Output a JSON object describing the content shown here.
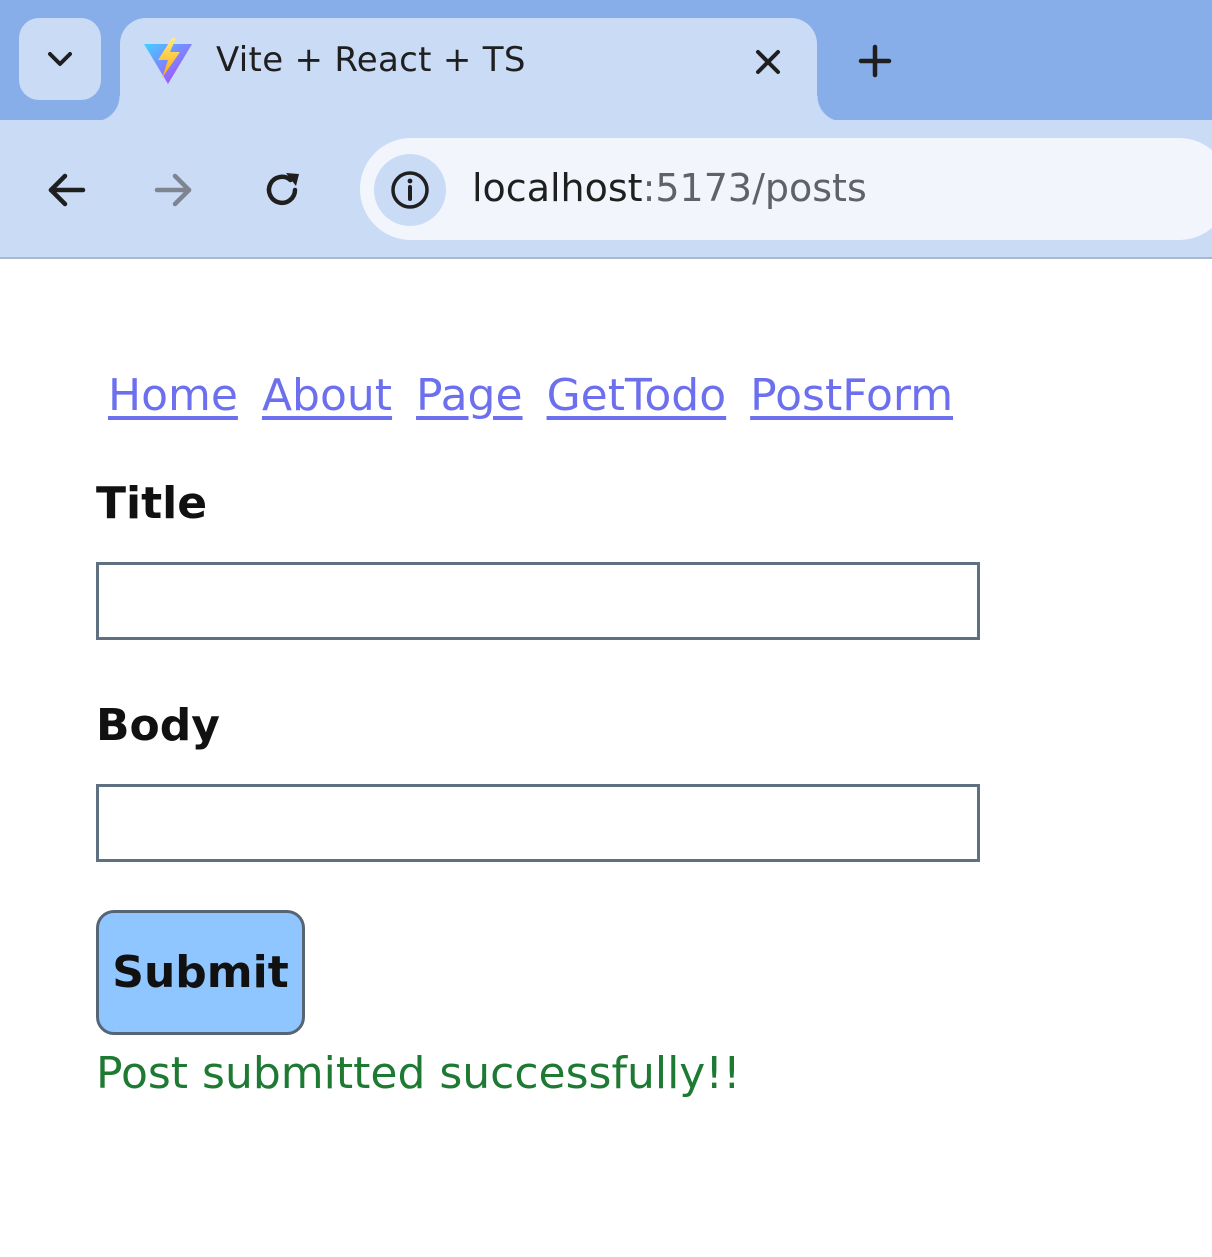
{
  "browser": {
    "tab": {
      "title": "Vite + React + TS",
      "favicon": "vite-logo-icon"
    },
    "address_bar": {
      "host": "localhost",
      "path": ":5173/posts"
    },
    "icons": {
      "tab_search": "chevron-down-icon",
      "tab_close": "close-icon",
      "new_tab": "plus-icon",
      "back": "arrow-left-icon",
      "forward": "arrow-right-icon",
      "reload": "reload-icon",
      "site_info": "info-icon"
    },
    "forward_enabled": false
  },
  "page": {
    "nav": {
      "links": [
        "Home",
        "About",
        "Page",
        "GetTodo",
        "PostForm"
      ]
    },
    "form": {
      "title_label": "Title",
      "title_value": "",
      "body_label": "Body",
      "body_value": "",
      "submit_label": "Submit"
    },
    "status_message": "Post submitted successfully!!"
  },
  "colors": {
    "tabstrip": "#87aee9",
    "toolbar": "#cadbf6",
    "link": "#6d70ee",
    "submit_button": "#90c6ff",
    "success_text": "#1e7a33"
  }
}
